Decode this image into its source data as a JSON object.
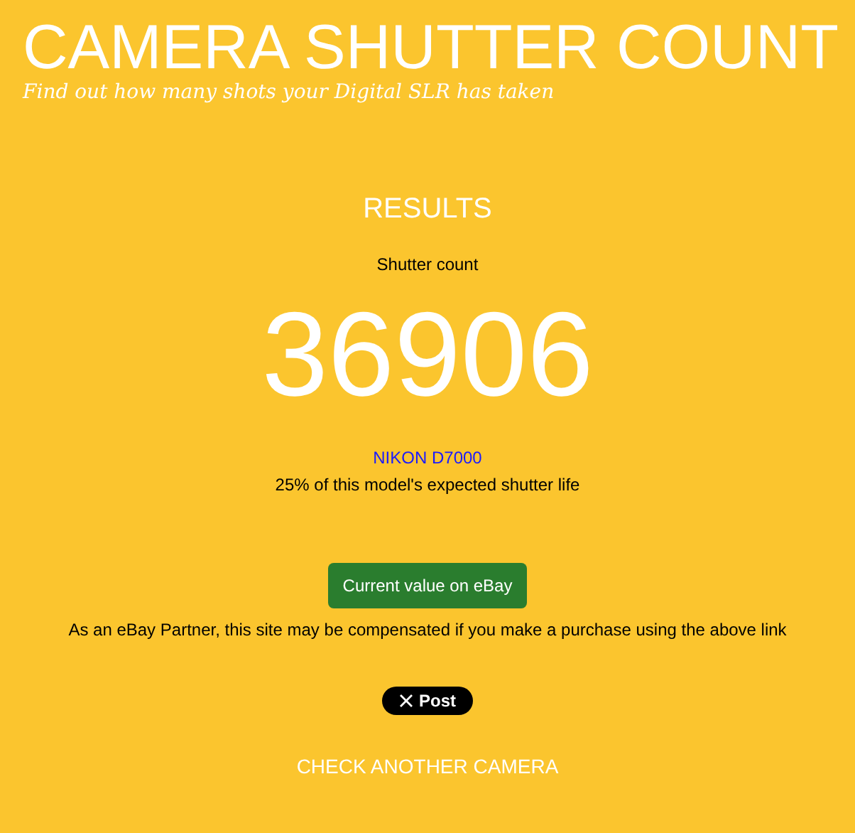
{
  "header": {
    "title": "CAMERA SHUTTER COUNT",
    "subtitle": "Find out how many shots your Digital SLR has taken"
  },
  "results": {
    "heading": "RESULTS",
    "label": "Shutter count",
    "count": "36906",
    "model": "NIKON D7000",
    "life_note": "25% of this model's expected shutter life"
  },
  "ebay": {
    "button": "Current value on eBay",
    "disclaimer": "As an eBay Partner, this site may be compensated if you make a purchase using the above link"
  },
  "post_button": "Post",
  "check_another": "CHECK ANOTHER CAMERA"
}
